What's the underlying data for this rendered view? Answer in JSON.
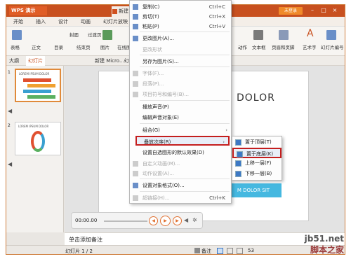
{
  "app": {
    "title": "WPS 演示",
    "doc_tab": "新建",
    "login": "未登录"
  },
  "menu": [
    "开始",
    "插入",
    "设计",
    "动画",
    "幻灯片放映"
  ],
  "ribbon": {
    "left_labels": [
      "表格",
      "正文",
      "封面",
      "目录",
      "过渡页",
      "结束页",
      "图片",
      "在线图片"
    ],
    "right_labels": [
      "动作",
      "文本框",
      "页眉和页脚",
      "艺术字",
      "幻灯片编号"
    ]
  },
  "tabs": {
    "outline": "大纲",
    "slides": "幻灯片",
    "doc_title": "新建 Micro...幻"
  },
  "thumbs": [
    {
      "num": "1",
      "title": "LOREM IPSUM DOLOR"
    },
    {
      "num": "2",
      "title": "LOREM IPSUM DOLOR"
    }
  ],
  "slide": {
    "heading": "DOLOR",
    "box_text": "M DOLOR SIT"
  },
  "player": {
    "time": "00:00.00"
  },
  "notes": {
    "placeholder": "单击添加备注"
  },
  "status": {
    "slide_info": "幻灯片 1 / 2",
    "notes_btn": "备注",
    "zoom": "53"
  },
  "context_menu": [
    {
      "label": "复制(C)",
      "shortcut": "Ctrl+C",
      "disabled": false,
      "icon": "copy-icon"
    },
    {
      "label": "剪切(T)",
      "shortcut": "Ctrl+X",
      "disabled": false,
      "icon": "cut-icon"
    },
    {
      "label": "粘贴(P)",
      "shortcut": "Ctrl+V",
      "disabled": false,
      "icon": "paste-icon"
    },
    {
      "label": "更改图片(A)...",
      "shortcut": "",
      "disabled": false,
      "icon": "image-icon"
    },
    {
      "label": "更改形状",
      "shortcut": "",
      "disabled": true,
      "icon": ""
    },
    {
      "label": "另存为图片(S)...",
      "shortcut": "",
      "disabled": false,
      "icon": ""
    },
    {
      "label": "字体(F)...",
      "shortcut": "",
      "disabled": true,
      "icon": "font-icon"
    },
    {
      "label": "段落(P)...",
      "shortcut": "",
      "disabled": true,
      "icon": "paragraph-icon"
    },
    {
      "label": "项目符号和编号(B)...",
      "shortcut": "",
      "disabled": true,
      "icon": "list-icon"
    },
    {
      "label": "播放声音(P)",
      "shortcut": "",
      "disabled": false,
      "icon": ""
    },
    {
      "label": "编辑声音对象(E)",
      "shortcut": "",
      "disabled": false,
      "icon": ""
    },
    {
      "label": "组合(G)",
      "shortcut": "",
      "disabled": false,
      "icon": "",
      "submenu": true
    },
    {
      "label": "叠放次序(R)",
      "shortcut": "",
      "disabled": false,
      "icon": "",
      "submenu": true,
      "highlight": true
    },
    {
      "label": "设置自选图形的默认效果(D)",
      "shortcut": "",
      "disabled": false,
      "icon": ""
    },
    {
      "label": "自定义动画(M)...",
      "shortcut": "",
      "disabled": true,
      "icon": "animation-icon"
    },
    {
      "label": "动作设置(A)...",
      "shortcut": "",
      "disabled": true,
      "icon": "action-icon"
    },
    {
      "label": "设置对象格式(O)...",
      "shortcut": "",
      "disabled": false,
      "icon": "format-icon"
    },
    {
      "label": "超链接(H)...",
      "shortcut": "Ctrl+K",
      "disabled": true,
      "icon": "link-icon"
    }
  ],
  "submenu": [
    {
      "label": "置于顶层(T)",
      "highlight": false
    },
    {
      "label": "置于底层(K)",
      "highlight": true
    },
    {
      "label": "上移一层(F)",
      "highlight": false
    },
    {
      "label": "下移一层(B)",
      "highlight": false
    }
  ],
  "watermark": {
    "line1": "jb51.net",
    "line2": "脚本之家"
  },
  "colors": {
    "accent": "#c8501f",
    "highlight_border": "#c41e1e",
    "slide_box": "#45b8e0"
  }
}
